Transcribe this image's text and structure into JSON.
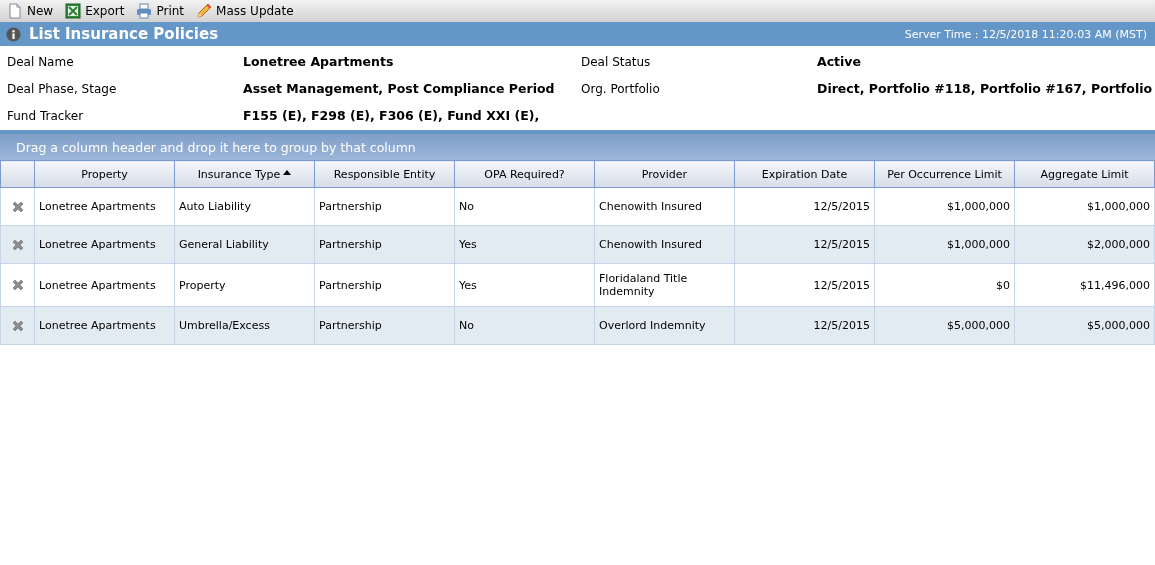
{
  "toolbar": [
    {
      "kind": "new",
      "label": "New"
    },
    {
      "kind": "export",
      "label": "Export"
    },
    {
      "kind": "print",
      "label": "Print"
    },
    {
      "kind": "edit",
      "label": "Mass Update"
    }
  ],
  "title_bar": {
    "title": "List Insurance Policies",
    "server_time": "Server Time : 12/5/2018 11:20:03 AM (MST)"
  },
  "details": [
    {
      "label": "Deal Name",
      "value": "Lonetree Apartments"
    },
    {
      "label": "Deal Status",
      "value": "Active"
    },
    {
      "label": "Deal Phase, Stage",
      "value": "Asset Management, Post Compliance Period"
    },
    {
      "label": "Org. Portfolio",
      "value": "Direct, Portfolio #118, Portfolio #167, Portfolio"
    },
    {
      "label": "Fund Tracker",
      "value": "F155 (E), F298 (E), F306 (E), Fund XXI (E),"
    }
  ],
  "group_bar": "Drag a column header and drop it here to group by that column",
  "table": {
    "columns": [
      {
        "label": "Property",
        "sorted": false
      },
      {
        "label": "Insurance Type",
        "sorted": true
      },
      {
        "label": "Responsible Entity",
        "sorted": false
      },
      {
        "label": "OPA Required?",
        "sorted": false
      },
      {
        "label": "Provider",
        "sorted": false
      },
      {
        "label": "Expiration Date",
        "sorted": false
      },
      {
        "label": "Per Occurrence Limit",
        "sorted": false
      },
      {
        "label": "Aggregate Limit",
        "sorted": false
      }
    ],
    "rows": [
      [
        "Lonetree Apartments",
        "Auto Liability",
        "Partnership",
        "No",
        "Chenowith Insured",
        "12/5/2015",
        "$1,000,000",
        "$1,000,000"
      ],
      [
        "Lonetree Apartments",
        "General Liability",
        "Partnership",
        "Yes",
        "Chenowith Insured",
        "12/5/2015",
        "$1,000,000",
        "$2,000,000"
      ],
      [
        "Lonetree Apartments",
        "Property",
        "Partnership",
        "Yes",
        "Floridaland Title Indemnity",
        "12/5/2015",
        "$0",
        "$11,496,000"
      ],
      [
        "Lonetree Apartments",
        "Umbrella/Excess",
        "Partnership",
        "No",
        "Overlord Indemnity",
        "12/5/2015",
        "$5,000,000",
        "$5,000,000"
      ]
    ]
  }
}
